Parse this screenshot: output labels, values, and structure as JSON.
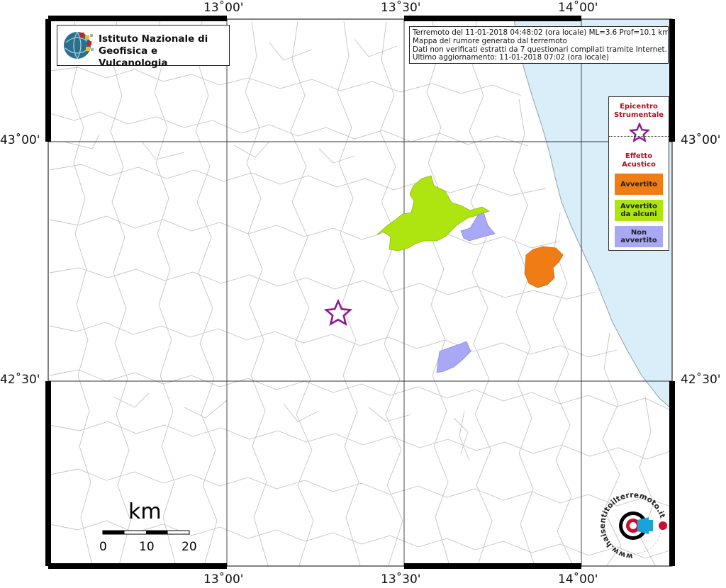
{
  "graticule": {
    "lon_labels": [
      "13˚00'",
      "13˚30'",
      "14˚00'"
    ],
    "lat_labels": [
      "43˚00'",
      "42˚30'"
    ]
  },
  "institute": {
    "line1": "Istituto Nazionale di",
    "line2": "Geofisica e Vulcanologia"
  },
  "info": {
    "line1": "Terremoto del 11-01-2018 04:48:02 (ora locale) ML=3.6 Prof=10.1 km",
    "line2": "Mappa del rumore generato dal terremoto",
    "line3": "Dati non verificati estratti da 7 questionari compilati tramite Internet.",
    "line4": "Ultimo aggiornamento: 11-01-2018 07:02 (ora locale)"
  },
  "legend": {
    "epicentre_title_1": "Epicentro",
    "epicentre_title_2": "Strumentale",
    "effect_title_1": "Effetto",
    "effect_title_2": "Acustico",
    "items": [
      {
        "label_1": "Avvertito",
        "label_2": "",
        "color": "#ef7c14"
      },
      {
        "label_1": "Avvertito",
        "label_2": "da alcuni",
        "color": "#aee510"
      },
      {
        "label_1": "Non",
        "label_2": "avvertito",
        "color": "#a8a8f4"
      }
    ],
    "star_color": "#8b1a8f"
  },
  "scale": {
    "unit": "km",
    "ticks": [
      "0",
      "10",
      "20"
    ]
  },
  "watermark": {
    "text": "www.haisentitoilterremoto.it"
  },
  "colors": {
    "sea": "#daeefa",
    "borders": "#c4c4c4",
    "grid": "#333333"
  }
}
